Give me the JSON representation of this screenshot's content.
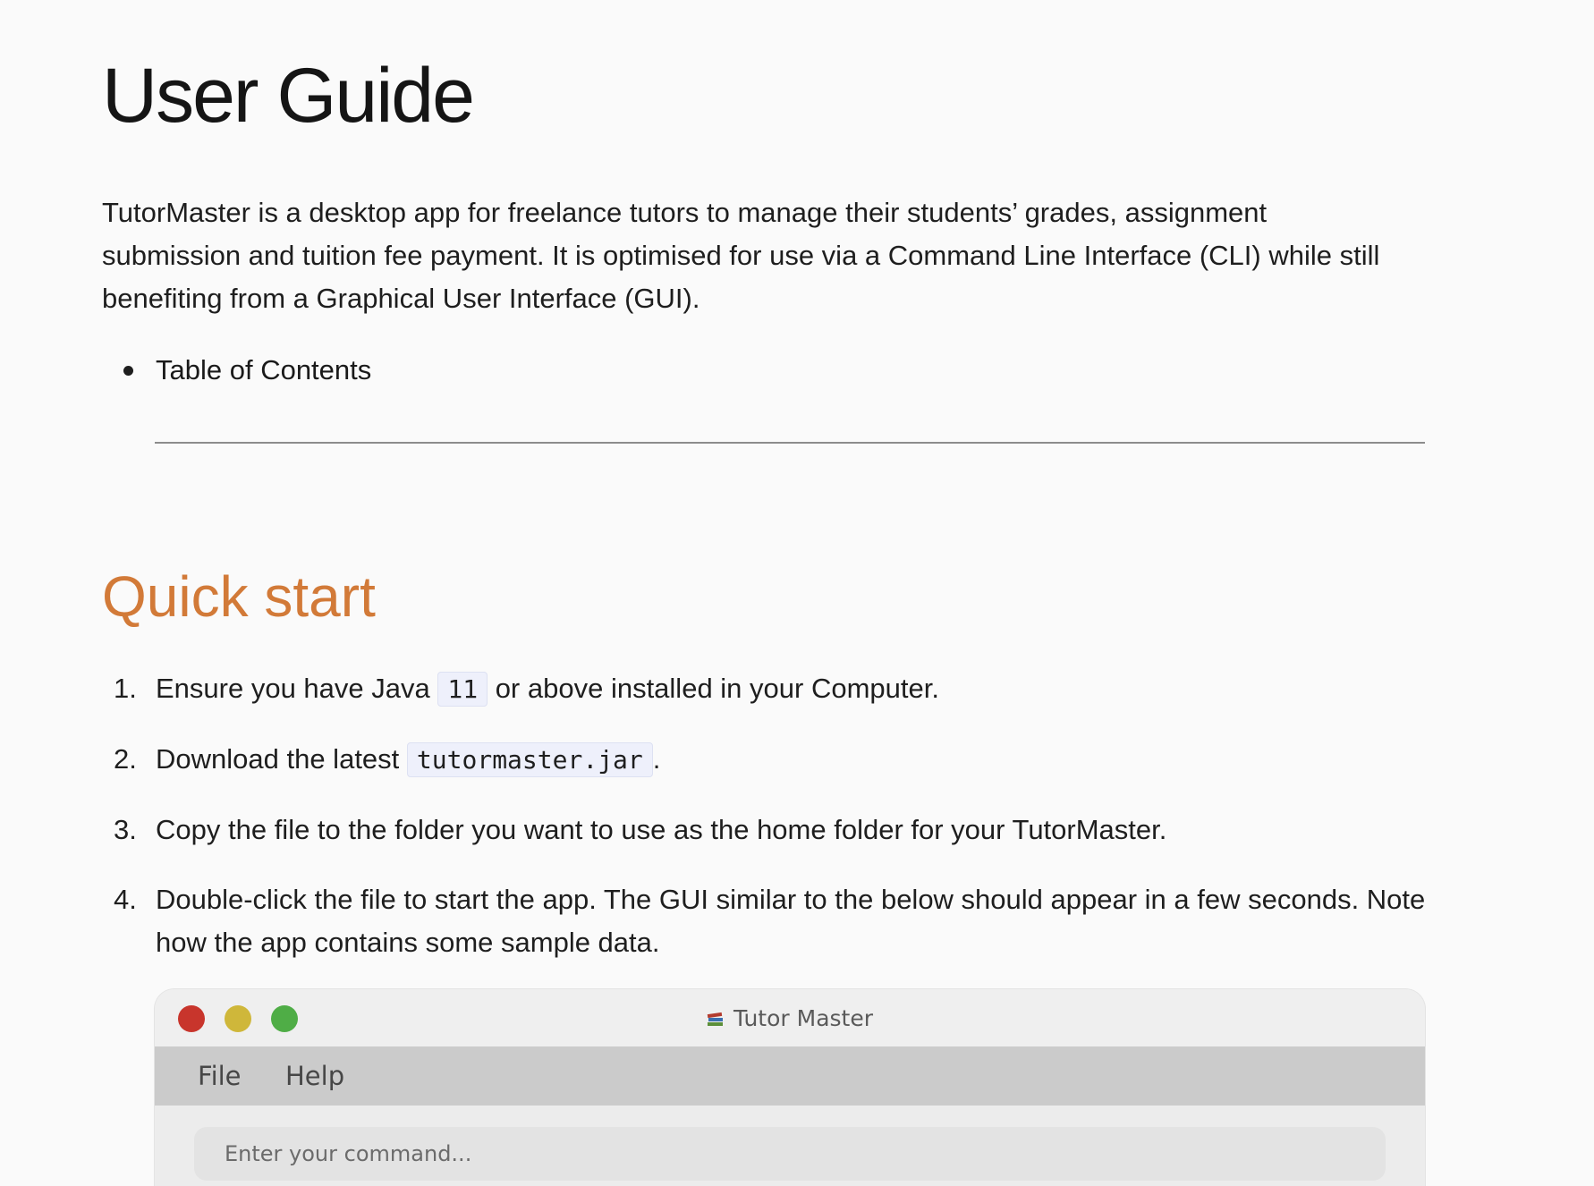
{
  "title": "User Guide",
  "intro": "TutorMaster is a desktop app for freelance tutors to manage their students’ grades, assignment submission and tuition fee payment. It is optimised for use via a Command Line Interface (CLI) while still benefiting from a Graphical User Interface (GUI).",
  "toc": {
    "items": [
      "Table of Contents"
    ]
  },
  "quick_start": {
    "heading": "Quick start",
    "steps": [
      {
        "num": "1.",
        "before": "Ensure you have Java ",
        "code": "11",
        "after": " or above installed in your Computer."
      },
      {
        "num": "2.",
        "before": "Download the latest ",
        "code": "tutormaster.jar",
        "after": "."
      },
      {
        "num": "3.",
        "text": "Copy the file to the folder you want to use as the home folder for your TutorMaster."
      },
      {
        "num": "4.",
        "text": "Double-click the file to start the app. The GUI similar to the below should appear in a few seconds. Note how the app contains some sample data."
      }
    ]
  },
  "app_screenshot": {
    "window_title": "Tutor Master",
    "menu": [
      "File",
      "Help"
    ],
    "command_placeholder": "Enter your command...",
    "traffic_lights": {
      "close": "#c8352c",
      "minimize": "#cfb73a",
      "zoom": "#4fad46"
    }
  },
  "colors": {
    "heading_accent": "#d27a38",
    "code_bg": "#eef0fb"
  }
}
